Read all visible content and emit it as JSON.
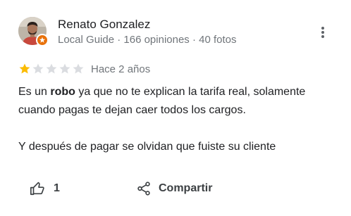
{
  "reviewer": {
    "name": "Renato Gonzalez",
    "meta": "Local Guide · 166 opiniones · 40 fotos",
    "avatar_icon": "person-photo-avatar",
    "badge_icon": "local-guide-badge-icon",
    "badge_color": "#e8710a"
  },
  "menu": {
    "icon": "more-vert-icon"
  },
  "rating": {
    "value": 1,
    "max": 5,
    "filled_color": "#fbbc04",
    "empty_color": "#dadce0",
    "date": "Hace 2 años"
  },
  "review": {
    "line1_before": "Es un ",
    "line1_bold": "robo",
    "line1_after": " ya que no te explican la tarifa real,  solamente cuando pagas te dejan caer todos los cargos.",
    "line2": "Y después de pagar se olvidan que fuiste su cliente"
  },
  "actions": {
    "like_icon": "thumb-up-icon",
    "like_count": "1",
    "share_icon": "share-icon",
    "share_label": "Compartir"
  }
}
